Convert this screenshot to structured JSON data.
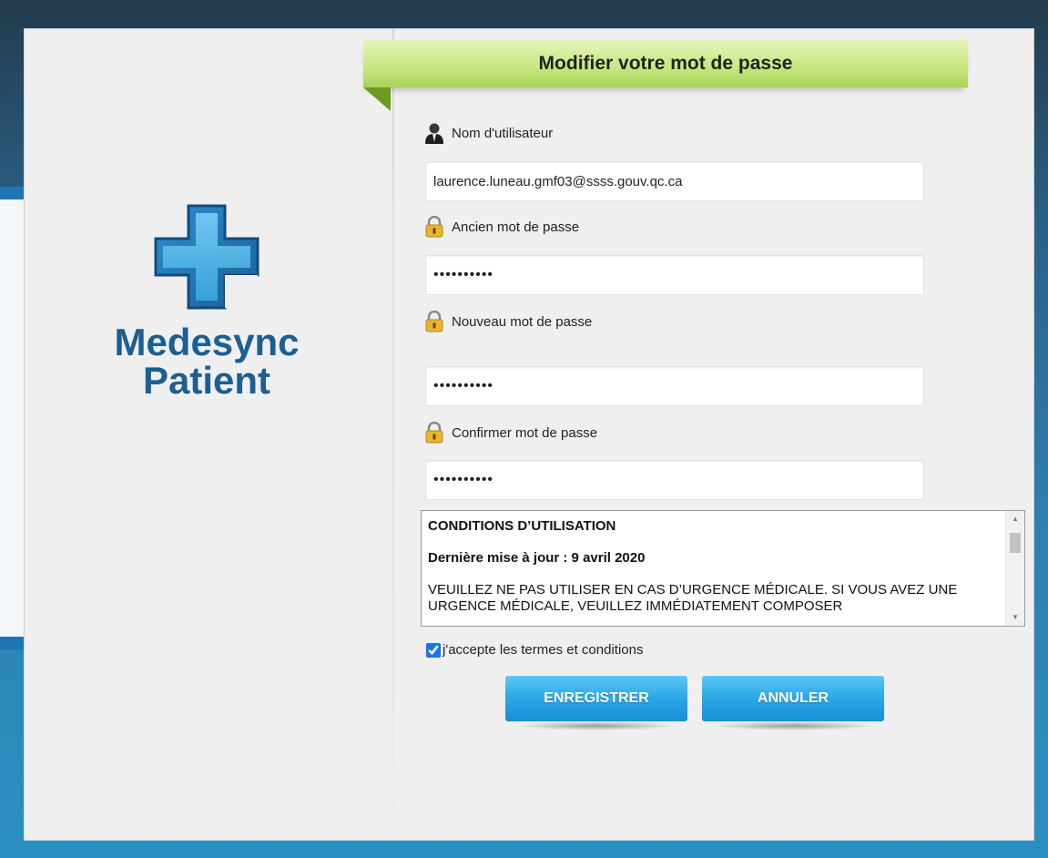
{
  "brand": {
    "line1": "Medesync",
    "line2": "Patient"
  },
  "colors": {
    "brand_blue": "#1b5f93",
    "header_green": "#c6e67d",
    "button_blue": "#2aa6e6"
  },
  "header": {
    "title": "Modifier votre mot de passe"
  },
  "form": {
    "username": {
      "icon": "user-icon",
      "label": "Nom d'utilisateur",
      "value": "laurence.luneau.gmf03@ssss.gouv.qc.ca"
    },
    "old_password": {
      "icon": "lock-icon",
      "label": "Ancien mot de passe",
      "value": "••••••••••"
    },
    "new_password": {
      "icon": "lock-icon",
      "label": "Nouveau mot de passe",
      "value": "••••••••••"
    },
    "confirm_password": {
      "icon": "lock-icon",
      "label": "Confirmer mot de passe",
      "value": "••••••••••"
    }
  },
  "terms": {
    "heading": "CONDITIONS D’UTILISATION",
    "updated": "Dernière mise à jour : 9 avril 2020",
    "body": "VEUILLEZ NE PAS UTILISER EN CAS D’URGENCE MÉDICALE. SI VOUS AVEZ UNE URGENCE MÉDICALE, VEUILLEZ IMMÉDIATEMENT COMPOSER",
    "accept_label": "j'accepte les termes et conditions",
    "accepted": true
  },
  "buttons": {
    "save": "ENREGISTRER",
    "cancel": "ANNULER"
  }
}
